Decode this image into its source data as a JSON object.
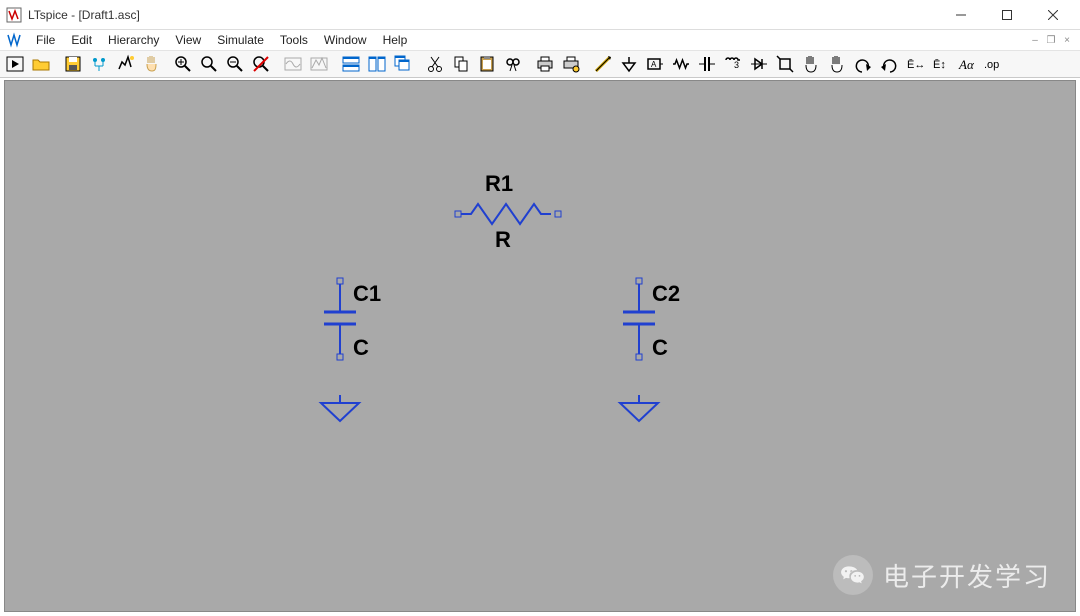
{
  "window": {
    "title": "LTspice - [Draft1.asc]"
  },
  "menu": {
    "items": [
      "File",
      "Edit",
      "Hierarchy",
      "View",
      "Simulate",
      "Tools",
      "Window",
      "Help"
    ]
  },
  "toolbar_icons": [
    "run-icon",
    "open-icon",
    "save-icon",
    "pick-icon",
    "simulate-icon",
    "pan-icon",
    "zoom-in-icon",
    "zoom-out-icon",
    "zoom-fit-icon",
    "zoom-off-icon",
    "waveform1-icon",
    "waveform2-icon",
    "tile-h-icon",
    "tile-v-icon",
    "cascade-icon",
    "cut-icon",
    "copy-icon",
    "paste-icon",
    "find-icon",
    "print-icon",
    "print-setup-icon",
    "wire-icon",
    "ground-icon",
    "net-label-icon",
    "resistor-icon",
    "capacitor-icon",
    "inductor-icon",
    "diode-icon",
    "component-icon",
    "move-icon",
    "drag-icon",
    "undo-icon",
    "redo-icon",
    "rotate-icon",
    "mirror-icon",
    "text-icon",
    "spice-directive-icon"
  ],
  "schematic": {
    "r1": {
      "name": "R1",
      "value": "R"
    },
    "c1": {
      "name": "C1",
      "value": "C"
    },
    "c2": {
      "name": "C2",
      "value": "C"
    }
  },
  "watermark": {
    "text": "电子开发学习"
  }
}
